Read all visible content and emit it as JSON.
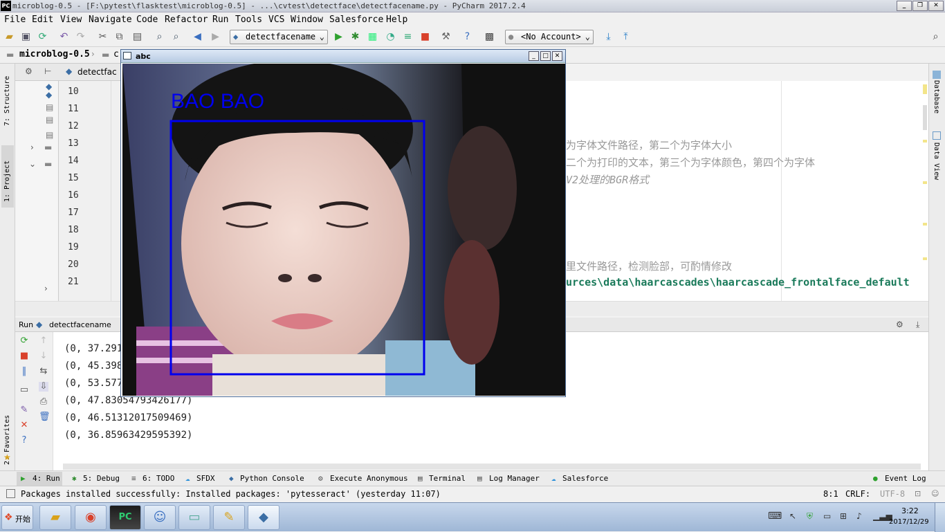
{
  "window": {
    "title": "microblog-0.5 - [F:\\pytest\\flasktest\\microblog-0.5] - ...\\cvtest\\detectface\\detectfacename.py - PyCharm 2017.2.4",
    "app_icon": "PC"
  },
  "menu": [
    "File",
    "Edit",
    "View",
    "Navigate",
    "Code",
    "Refactor",
    "Run",
    "Tools",
    "VCS",
    "Window",
    "Salesforce",
    "Help"
  ],
  "toolbar": {
    "run_config": "detectfacename",
    "account": "<No Account>"
  },
  "navbar": {
    "crumb1": "microblog-0.5",
    "crumb2": "c"
  },
  "project_panel": {
    "file_tab": "detectfac"
  },
  "side_tabs": {
    "structure": "7: Structure",
    "project": "1: Project",
    "favorites": "2: Favorites",
    "database": "Database",
    "dataview": "Data View"
  },
  "gutter": {
    "line_numbers": [
      "10",
      "11",
      "12",
      "13",
      "14",
      "15",
      "16",
      "17",
      "18",
      "19",
      "20",
      "21"
    ]
  },
  "editor": {
    "comment1": "为字体文件路径，第二个为字体大小",
    "comment2": "二个为打印的文本，第三个为字体颜色，第四个为字体",
    "comment3": "V2处理的BGR格式",
    "comment4": "里文件路径，检测脸部，可酌情修改",
    "path": "urces\\data\\haarcascades\\haarcascade_frontalface_default"
  },
  "run_panel": {
    "label": "Run",
    "config": "detectfacename"
  },
  "console": {
    "lines": [
      "(0, 37.291",
      "(0, 45.398",
      "(0, 53.577",
      "(0, 47.83054793426177)",
      "(0, 46.51312017509469)",
      "(0, 36.85963429595392)"
    ]
  },
  "bottom_tabs": [
    "4: Run",
    "5: Debug",
    "6: TODO",
    "SFDX",
    "Python Console",
    "Execute Anonymous",
    "Terminal",
    "Log Manager",
    "Salesforce"
  ],
  "event_log": "Event Log",
  "status": {
    "message": "Packages installed successfully: Installed packages: 'pytesseract' (yesterday 11:07)",
    "position": "8:1",
    "line_sep": "CRLF:",
    "encoding": "UTF-8"
  },
  "taskbar": {
    "start": "开始",
    "time": "3:22",
    "date": "2017/12/29"
  },
  "float_window": {
    "title": "abc",
    "overlay_text": "BAO  BAO"
  }
}
